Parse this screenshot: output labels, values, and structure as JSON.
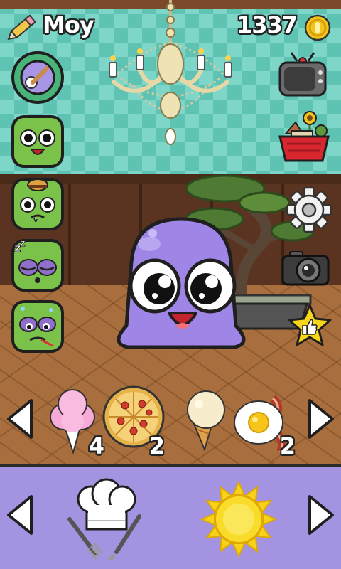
{
  "header": {
    "pet_name": "Moy",
    "coins": "1337"
  },
  "left_menu": [
    {
      "name": "games",
      "icon": "baseball-icon"
    },
    {
      "name": "happy",
      "icon": "happy-face-icon"
    },
    {
      "name": "hungry",
      "icon": "hungry-face-icon"
    },
    {
      "name": "sleepy",
      "icon": "sleepy-face-icon"
    },
    {
      "name": "sick",
      "icon": "sick-face-icon"
    }
  ],
  "right_menu": [
    "tv-icon",
    "shop-basket-icon",
    "gear-icon",
    "camera-icon",
    "thumbs-up-star-icon"
  ],
  "food_tray": {
    "items": [
      {
        "name": "cotton candy",
        "count": "4"
      },
      {
        "name": "pizza",
        "count": "2"
      },
      {
        "name": "ice cream",
        "count": ""
      },
      {
        "name": "egg and bacon",
        "count": "2"
      }
    ]
  },
  "bottom_bar": {
    "left_action": "kitchen-chef-icon",
    "right_action": "sun-icon"
  },
  "colors": {
    "pet": "#9f86e6",
    "bottom_bar": "#a493e0",
    "wallpaper": "#5fc3b4",
    "coin": "#f4c51a"
  }
}
